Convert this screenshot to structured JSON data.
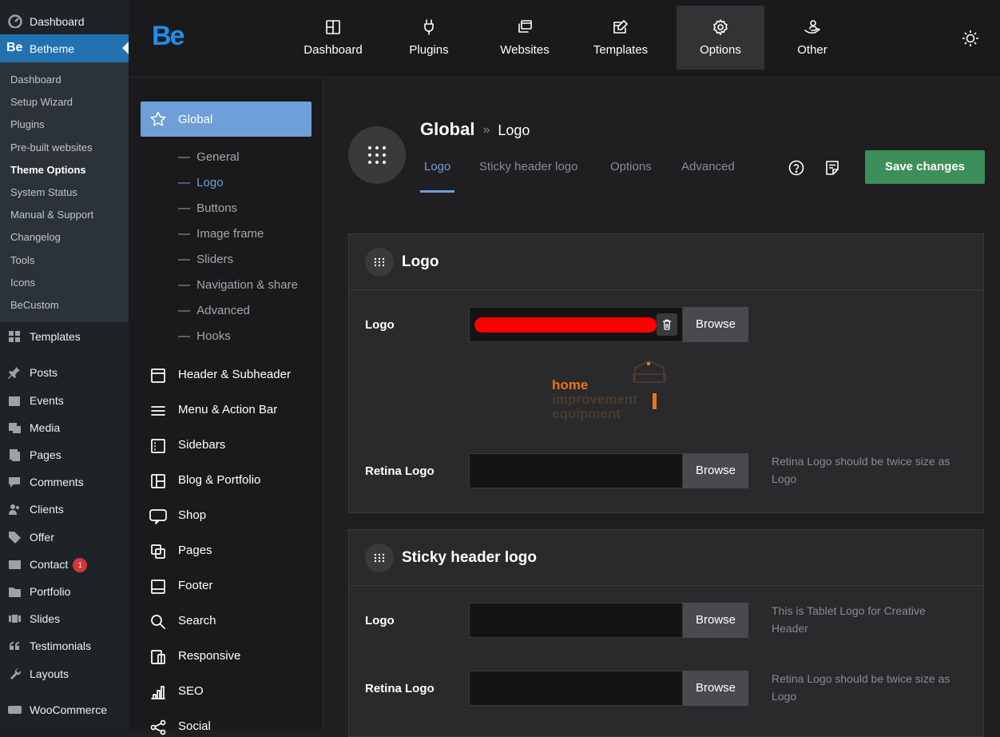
{
  "wp_menu": {
    "dashboard": "Dashboard",
    "betheme": "Betheme",
    "submenu": [
      "Dashboard",
      "Setup Wizard",
      "Plugins",
      "Pre-built websites",
      "Theme Options",
      "System Status",
      "Manual & Support",
      "Changelog",
      "Tools",
      "Icons",
      "BeCustom"
    ],
    "current_submenu": "Theme Options",
    "items": [
      {
        "label": "Templates",
        "icon": "templates-icon"
      },
      {
        "label": "Posts",
        "icon": "pin-icon"
      },
      {
        "label": "Events",
        "icon": "calendar-icon"
      },
      {
        "label": "Media",
        "icon": "media-icon"
      },
      {
        "label": "Pages",
        "icon": "pages-icon"
      },
      {
        "label": "Comments",
        "icon": "comment-icon"
      },
      {
        "label": "Clients",
        "icon": "users-icon"
      },
      {
        "label": "Offer",
        "icon": "tag-icon"
      },
      {
        "label": "Contact",
        "icon": "mail-icon",
        "badge": "1"
      },
      {
        "label": "Portfolio",
        "icon": "folder-icon"
      },
      {
        "label": "Slides",
        "icon": "slides-icon"
      },
      {
        "label": "Testimonials",
        "icon": "quote-icon"
      },
      {
        "label": "Layouts",
        "icon": "wrench-icon"
      },
      {
        "label": "WooCommerce",
        "icon": "woo-icon"
      }
    ]
  },
  "topbar": {
    "logo": "Be",
    "nav": [
      {
        "label": "Dashboard",
        "icon": "dashboard-grid-icon"
      },
      {
        "label": "Plugins",
        "icon": "plug-icon"
      },
      {
        "label": "Websites",
        "icon": "websites-icon"
      },
      {
        "label": "Templates",
        "icon": "template-edit-icon"
      },
      {
        "label": "Options",
        "icon": "gear-icon",
        "active": true
      },
      {
        "label": "Other",
        "icon": "hand-user-icon"
      }
    ]
  },
  "options_nav": {
    "global": "Global",
    "global_sub": [
      "General",
      "Logo",
      "Buttons",
      "Image frame",
      "Sliders",
      "Navigation & share",
      "Advanced",
      "Hooks"
    ],
    "current": "Logo",
    "sections": [
      {
        "label": "Header & Subheader",
        "icon": "header-icon"
      },
      {
        "label": "Menu & Action Bar",
        "icon": "menu-icon"
      },
      {
        "label": "Sidebars",
        "icon": "sidebar-icon"
      },
      {
        "label": "Blog & Portfolio",
        "icon": "blog-icon"
      },
      {
        "label": "Shop",
        "icon": "woo-icon"
      },
      {
        "label": "Pages",
        "icon": "pages-icon"
      },
      {
        "label": "Footer",
        "icon": "footer-icon"
      },
      {
        "label": "Search",
        "icon": "search-icon"
      },
      {
        "label": "Responsive",
        "icon": "responsive-icon"
      },
      {
        "label": "SEO",
        "icon": "seo-icon"
      },
      {
        "label": "Social",
        "icon": "share-icon"
      }
    ]
  },
  "main": {
    "breadcrumb_root": "Global",
    "breadcrumb_sep": "»",
    "breadcrumb_leaf": "Logo",
    "tabs": [
      "Logo",
      "Sticky header logo",
      "Options",
      "Advanced"
    ],
    "save_label": "Save changes",
    "logo_card": {
      "title": "Logo",
      "fields": [
        {
          "label": "Logo",
          "button": "Browse",
          "hint": ""
        },
        {
          "label": "Retina Logo",
          "button": "Browse",
          "hint": "Retina Logo should be twice size as Logo"
        }
      ],
      "preview": {
        "line1": "home",
        "line2": "improvement",
        "line3": "equipment"
      }
    },
    "sticky_card": {
      "title": "Sticky header logo",
      "fields": [
        {
          "label": "Logo",
          "button": "Browse",
          "hint": "This is Tablet Logo for Creative Header"
        },
        {
          "label": "Retina Logo",
          "button": "Browse",
          "hint": "Retina Logo should be twice size as Logo"
        }
      ]
    }
  },
  "colors": {
    "accent": "#6e9fd8",
    "save": "#3d8f5a",
    "wp_active": "#2271b1",
    "brand": "#1f8ef1",
    "preview_orange": "#e8741e"
  }
}
